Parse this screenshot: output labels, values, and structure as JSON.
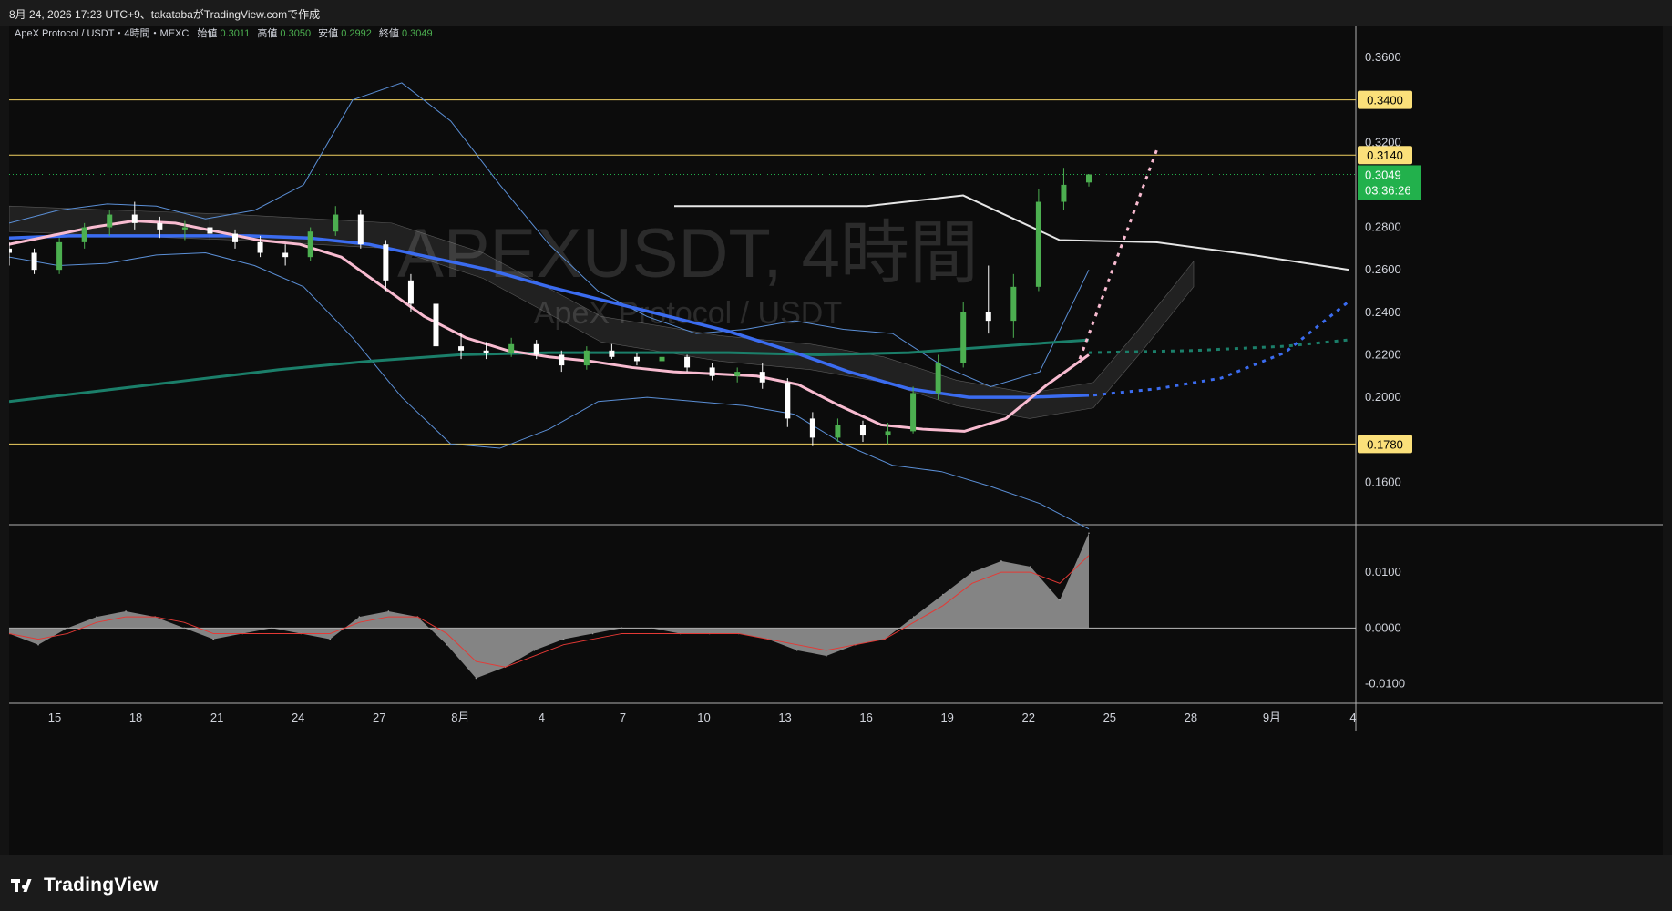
{
  "header": {
    "caption": "8月 24, 2026 17:23 UTC+9、takatabaがTradingView.comで作成"
  },
  "legend": {
    "symbol": "ApeX Protocol / USDT・4時間・MEXC",
    "open_label": "始値",
    "open": "0.3011",
    "high_label": "高値",
    "high": "0.3050",
    "low_label": "安値",
    "low": "0.2992",
    "close_label": "終値",
    "close": "0.3049"
  },
  "watermark": {
    "line1": "APEXUSDT, 4時間",
    "line2": "ApeX Protocol / USDT"
  },
  "branding": {
    "name": "TradingView"
  },
  "colors": {
    "background": "#0c0c0c",
    "up": "#4caf50",
    "down": "#ffffff",
    "level_line": "#f0d060",
    "level_badge": "#fbe07a",
    "price_badge": "#22b14c",
    "ma_pink": "#f8bbd0",
    "ma_blue": "#3b6cf0",
    "ma_teal": "#1b7f6a",
    "bollinger": "#5b8fd6",
    "macd_hist": "#9a9a9a",
    "macd_signal": "#e53935"
  },
  "chart_data": [
    {
      "type": "candlestick",
      "name": "price",
      "timeframe": "4時間",
      "ylim": [
        0.14,
        0.375
      ],
      "y_ticks": [
        "0.3600",
        "0.3200",
        "0.2800",
        "0.2600",
        "0.2400",
        "0.2200",
        "0.2000",
        "0.1600"
      ],
      "x_ticks": [
        "15",
        "18",
        "21",
        "24",
        "27",
        "8月",
        "4",
        "7",
        "10",
        "13",
        "16",
        "19",
        "22",
        "25",
        "28",
        "9月",
        "4"
      ],
      "horizontal_levels": [
        {
          "value": 0.34,
          "label": "0.3400"
        },
        {
          "value": 0.314,
          "label": "0.3140"
        },
        {
          "value": 0.178,
          "label": "0.1780"
        }
      ],
      "last_price": {
        "value": 0.3049,
        "label": "0.3049",
        "countdown": "03:36:26"
      },
      "candles": [
        [
          0.27,
          0.273,
          0.262,
          0.268
        ],
        [
          0.268,
          0.27,
          0.258,
          0.26
        ],
        [
          0.26,
          0.275,
          0.258,
          0.273
        ],
        [
          0.273,
          0.282,
          0.27,
          0.28
        ],
        [
          0.28,
          0.288,
          0.276,
          0.286
        ],
        [
          0.286,
          0.292,
          0.279,
          0.282
        ],
        [
          0.282,
          0.285,
          0.275,
          0.279
        ],
        [
          0.279,
          0.283,
          0.274,
          0.28
        ],
        [
          0.28,
          0.284,
          0.274,
          0.277
        ],
        [
          0.277,
          0.279,
          0.27,
          0.273
        ],
        [
          0.273,
          0.276,
          0.266,
          0.268
        ],
        [
          0.268,
          0.272,
          0.262,
          0.266
        ],
        [
          0.266,
          0.28,
          0.264,
          0.278
        ],
        [
          0.278,
          0.29,
          0.276,
          0.286
        ],
        [
          0.286,
          0.288,
          0.27,
          0.272
        ],
        [
          0.272,
          0.274,
          0.25,
          0.255
        ],
        [
          0.255,
          0.258,
          0.24,
          0.244
        ],
        [
          0.244,
          0.246,
          0.21,
          0.224
        ],
        [
          0.224,
          0.23,
          0.218,
          0.222
        ],
        [
          0.222,
          0.226,
          0.218,
          0.221
        ],
        [
          0.221,
          0.228,
          0.219,
          0.225
        ],
        [
          0.225,
          0.227,
          0.218,
          0.22
        ],
        [
          0.22,
          0.222,
          0.212,
          0.215
        ],
        [
          0.215,
          0.224,
          0.213,
          0.222
        ],
        [
          0.222,
          0.225,
          0.218,
          0.219
        ],
        [
          0.219,
          0.221,
          0.215,
          0.217
        ],
        [
          0.217,
          0.222,
          0.214,
          0.219
        ],
        [
          0.219,
          0.22,
          0.212,
          0.214
        ],
        [
          0.214,
          0.216,
          0.208,
          0.21
        ],
        [
          0.21,
          0.214,
          0.207,
          0.212
        ],
        [
          0.212,
          0.216,
          0.204,
          0.207
        ],
        [
          0.207,
          0.209,
          0.186,
          0.19
        ],
        [
          0.19,
          0.193,
          0.177,
          0.181
        ],
        [
          0.181,
          0.19,
          0.179,
          0.187
        ],
        [
          0.187,
          0.189,
          0.179,
          0.182
        ],
        [
          0.182,
          0.188,
          0.178,
          0.184
        ],
        [
          0.184,
          0.205,
          0.183,
          0.202
        ],
        [
          0.202,
          0.22,
          0.199,
          0.216
        ],
        [
          0.216,
          0.245,
          0.214,
          0.24
        ],
        [
          0.24,
          0.262,
          0.23,
          0.236
        ],
        [
          0.236,
          0.258,
          0.228,
          0.252
        ],
        [
          0.252,
          0.298,
          0.25,
          0.292
        ],
        [
          0.292,
          0.308,
          0.288,
          0.3
        ],
        [
          0.3011,
          0.305,
          0.2992,
          0.3049
        ]
      ],
      "ma_pink": [
        0.272,
        0.276,
        0.28,
        0.283,
        0.282,
        0.278,
        0.274,
        0.272,
        0.266,
        0.252,
        0.238,
        0.228,
        0.222,
        0.219,
        0.217,
        0.214,
        0.212,
        0.211,
        0.21,
        0.206,
        0.196,
        0.187,
        0.185,
        0.184,
        0.19,
        0.206,
        0.22
      ],
      "ma_blue": [
        0.275,
        0.276,
        0.276,
        0.276,
        0.276,
        0.275,
        0.272,
        0.266,
        0.26,
        0.252,
        0.245,
        0.238,
        0.231,
        0.222,
        0.212,
        0.204,
        0.2,
        0.2,
        0.201
      ],
      "ma_teal": [
        0.198,
        0.203,
        0.208,
        0.213,
        0.217,
        0.22,
        0.221,
        0.221,
        0.221,
        0.22,
        0.221,
        0.224,
        0.227
      ],
      "white_line_values": [
        0.29,
        0.29,
        0.29,
        0.295,
        0.274,
        0.273,
        0.267,
        0.26
      ]
    },
    {
      "type": "area",
      "name": "MACD",
      "ylim": [
        -0.0135,
        0.0185
      ],
      "y_ticks": [
        "0.0100",
        "0.0000",
        "-0.0100"
      ],
      "histogram": [
        -0.001,
        -0.003,
        0.0,
        0.002,
        0.003,
        0.002,
        0.0,
        -0.002,
        -0.001,
        0.0,
        -0.001,
        -0.002,
        0.002,
        0.003,
        0.002,
        -0.003,
        -0.009,
        -0.007,
        -0.004,
        -0.002,
        -0.001,
        0.0,
        0.0,
        -0.001,
        -0.001,
        -0.001,
        -0.002,
        -0.004,
        -0.005,
        -0.003,
        -0.002,
        0.002,
        0.006,
        0.01,
        0.012,
        0.011,
        0.005,
        0.017
      ],
      "signal": [
        -0.001,
        -0.002,
        -0.001,
        0.001,
        0.002,
        0.002,
        0.001,
        -0.001,
        -0.001,
        -0.001,
        -0.001,
        -0.001,
        0.001,
        0.002,
        0.002,
        -0.001,
        -0.006,
        -0.007,
        -0.005,
        -0.003,
        -0.002,
        -0.001,
        -0.001,
        -0.001,
        -0.001,
        -0.001,
        -0.002,
        -0.003,
        -0.004,
        -0.003,
        -0.002,
        0.001,
        0.004,
        0.008,
        0.01,
        0.01,
        0.008,
        0.013
      ]
    }
  ]
}
